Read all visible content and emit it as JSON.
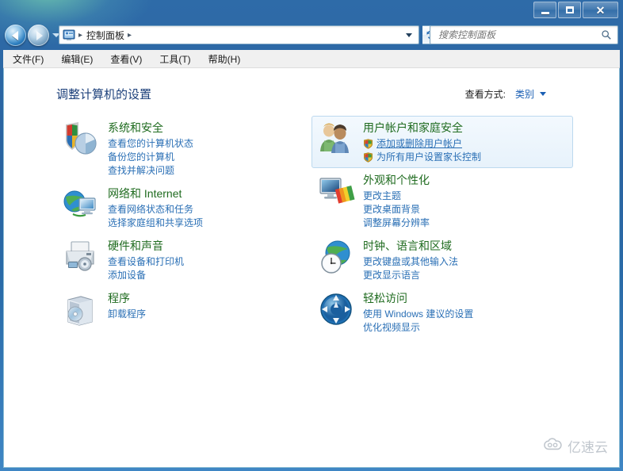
{
  "window": {
    "controls": {
      "minimize": "–",
      "maximize": "□",
      "close": "X"
    }
  },
  "nav": {
    "back_tooltip": "后退",
    "forward_tooltip": "前进",
    "breadcrumb": [
      "控制面板"
    ],
    "refresh_tooltip": "刷新"
  },
  "search": {
    "placeholder": "搜索控制面板",
    "value": ""
  },
  "menu": {
    "items": [
      {
        "label": "文件(F)"
      },
      {
        "label": "编辑(E)"
      },
      {
        "label": "查看(V)"
      },
      {
        "label": "工具(T)"
      },
      {
        "label": "帮助(H)"
      }
    ]
  },
  "main": {
    "page_title": "调整计算机的设置",
    "view_by": {
      "label": "查看方式:",
      "value": "类别"
    },
    "left_column": [
      {
        "icon": "shield-security-icon",
        "title": "系统和安全",
        "links": [
          {
            "text": "查看您的计算机状态",
            "shield": false,
            "underline": false
          },
          {
            "text": "备份您的计算机",
            "shield": false,
            "underline": false
          },
          {
            "text": "查找并解决问题",
            "shield": false,
            "underline": false
          }
        ]
      },
      {
        "icon": "network-globe-icon",
        "title": "网络和 Internet",
        "links": [
          {
            "text": "查看网络状态和任务",
            "shield": false,
            "underline": false
          },
          {
            "text": "选择家庭组和共享选项",
            "shield": false,
            "underline": false
          }
        ]
      },
      {
        "icon": "printer-hardware-icon",
        "title": "硬件和声音",
        "links": [
          {
            "text": "查看设备和打印机",
            "shield": false,
            "underline": false
          },
          {
            "text": "添加设备",
            "shield": false,
            "underline": false
          }
        ]
      },
      {
        "icon": "programs-box-icon",
        "title": "程序",
        "links": [
          {
            "text": "卸载程序",
            "shield": false,
            "underline": false
          }
        ]
      }
    ],
    "right_column": [
      {
        "icon": "user-accounts-icon",
        "title": "用户帐户和家庭安全",
        "highlighted": true,
        "links": [
          {
            "text": "添加或删除用户帐户",
            "shield": true,
            "underline": true
          },
          {
            "text": "为所有用户设置家长控制",
            "shield": true,
            "underline": false
          }
        ]
      },
      {
        "icon": "appearance-monitor-icon",
        "title": "外观和个性化",
        "highlighted": false,
        "links": [
          {
            "text": "更改主题",
            "shield": false,
            "underline": false
          },
          {
            "text": "更改桌面背景",
            "shield": false,
            "underline": false
          },
          {
            "text": "调整屏幕分辨率",
            "shield": false,
            "underline": false
          }
        ]
      },
      {
        "icon": "clock-region-icon",
        "title": "时钟、语言和区域",
        "highlighted": false,
        "links": [
          {
            "text": "更改键盘或其他输入法",
            "shield": false,
            "underline": false
          },
          {
            "text": "更改显示语言",
            "shield": false,
            "underline": false
          }
        ]
      },
      {
        "icon": "ease-of-access-icon",
        "title": "轻松访问",
        "highlighted": false,
        "links": [
          {
            "text": "使用 Windows 建议的设置",
            "shield": false,
            "underline": false
          },
          {
            "text": "优化视频显示",
            "shield": false,
            "underline": false
          }
        ]
      }
    ]
  },
  "watermark": {
    "text": "亿速云",
    "icon": "cloud-logo-icon"
  },
  "colors": {
    "title_text": "#1b3f7a",
    "category_title": "#1f6b1f",
    "link": "#2a6fb5",
    "highlight_bg": "#e7f2fb",
    "highlight_border": "#bcd9ef"
  }
}
